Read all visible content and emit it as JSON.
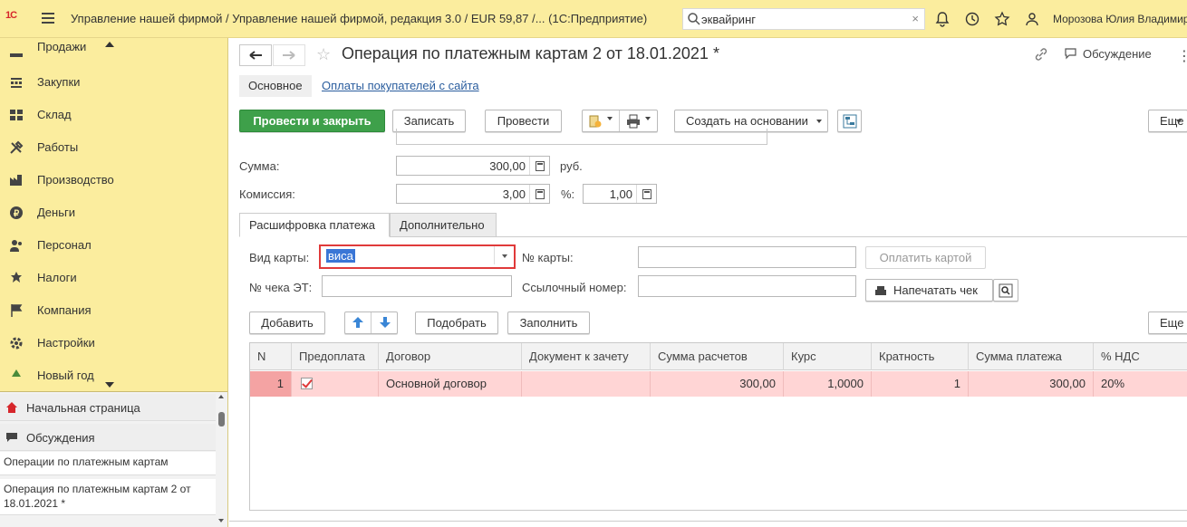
{
  "topbar": {
    "logo": "1С",
    "app_title": "Управление нашей фирмой / Управление нашей фирмой, редакция 3.0 / EUR 59,87 /...   (1С:Предприятие)",
    "search_value": "эквайринг",
    "search_clear": "×",
    "user_name": "Морозова Юлия Владимиров..."
  },
  "sidebar": {
    "items": [
      {
        "label": "Продажи",
        "icon": "sales-icon"
      },
      {
        "label": "Закупки",
        "icon": "purchases-icon"
      },
      {
        "label": "Склад",
        "icon": "warehouse-icon"
      },
      {
        "label": "Работы",
        "icon": "works-icon"
      },
      {
        "label": "Производство",
        "icon": "production-icon"
      },
      {
        "label": "Деньги",
        "icon": "money-icon"
      },
      {
        "label": "Персонал",
        "icon": "staff-icon"
      },
      {
        "label": "Налоги",
        "icon": "taxes-icon"
      },
      {
        "label": "Компания",
        "icon": "company-icon"
      },
      {
        "label": "Настройки",
        "icon": "settings-icon"
      },
      {
        "label": "Новый год",
        "icon": "new-year-icon"
      }
    ],
    "nav": [
      {
        "label": "Начальная страница",
        "icon": "home-icon"
      },
      {
        "label": "Обсуждения",
        "icon": "discussions-icon"
      }
    ],
    "open_windows": [
      "Операции по платежным картам",
      "Операция по платежным картам 2 от 18.01.2021 *"
    ]
  },
  "document": {
    "title": "Операция по платежным картам 2 от 18.01.2021 *",
    "discuss_label": "Обсуждение",
    "more": "⋮",
    "tabs": {
      "main": "Основное",
      "link": "Оплаты покупателей с сайта"
    }
  },
  "toolbar": {
    "post_and_close": "Провести и закрыть",
    "save": "Записать",
    "post": "Провести",
    "create_based_on": "Создать на основании",
    "more": "Еще"
  },
  "form": {
    "sum_label": "Сумма:",
    "sum_value": "300,00",
    "currency": "руб.",
    "commission_label": "Комиссия:",
    "commission_value": "3,00",
    "percent_label": "%:",
    "percent_value": "1,00"
  },
  "subtabs": {
    "decoding": "Расшифровка платежа",
    "additional": "Дополнительно"
  },
  "payment": {
    "card_type_label": "Вид карты:",
    "card_type_value": "виса",
    "card_number_label": "№ карты:",
    "pay_by_card": "Оплатить картой",
    "et_check_label": "№ чека ЭТ:",
    "reference_label": "Ссылочный номер:",
    "print_receipt": "Напечатать чек"
  },
  "table_toolbar": {
    "add": "Добавить",
    "pick": "Подобрать",
    "fill": "Заполнить",
    "more": "Еще"
  },
  "table": {
    "columns": [
      "N",
      "Предоплата",
      "Договор",
      "Документ к зачету",
      "Сумма расчетов",
      "Курс",
      "Кратность",
      "Сумма платежа",
      "% НДС"
    ],
    "rows": [
      {
        "n": "1",
        "prepayment": true,
        "contract": "Основной договор",
        "offset_document": "",
        "settlement_sum": "300,00",
        "rate": "1,0000",
        "multiplicity": "1",
        "payment_sum": "300,00",
        "vat": "20%"
      }
    ]
  },
  "colors": {
    "topbar_bg": "#fbed9e",
    "primary_button": "#3ea04a",
    "row_highlight": "#ffd5d5",
    "focus_border": "#e03a3a",
    "link": "#2a5d9e"
  }
}
